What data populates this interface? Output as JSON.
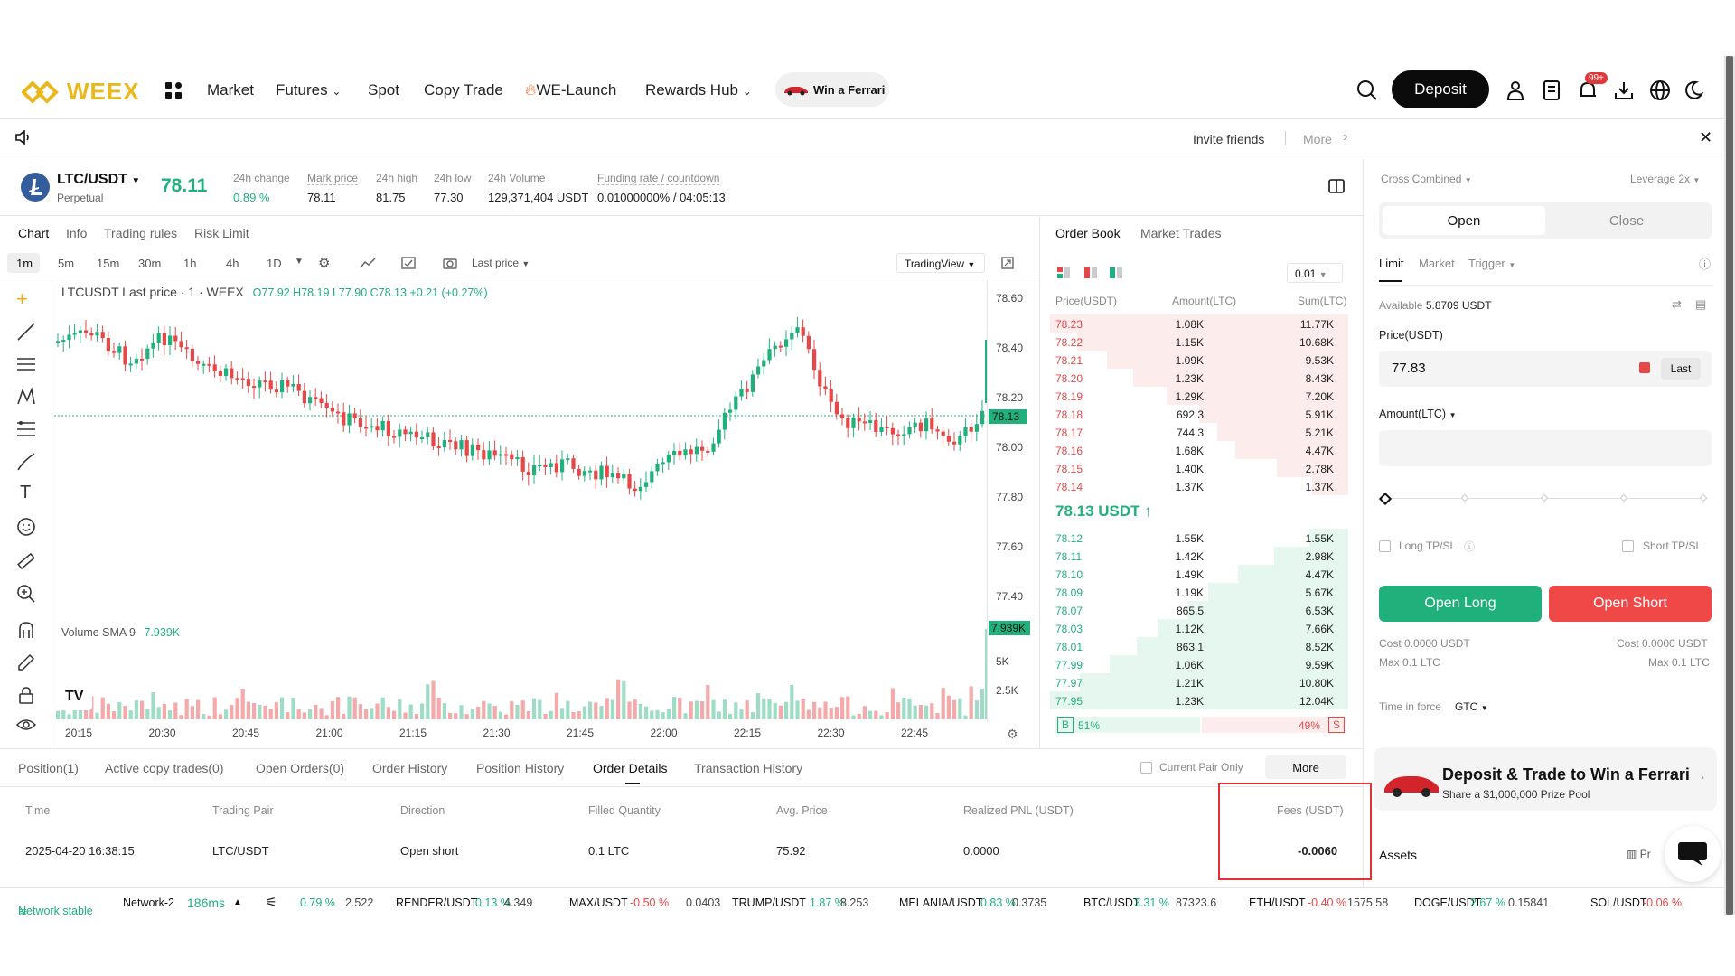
{
  "nav": {
    "brand": "WEEX",
    "market": "Market",
    "futures": "Futures",
    "spot": "Spot",
    "copy_trade": "Copy Trade",
    "we_launch": "WE-Launch",
    "rewards_hub": "Rewards Hub",
    "win_ferrari": "Win a Ferrari",
    "deposit": "Deposit",
    "notif_badge": "99+"
  },
  "announce": {
    "invite": "Invite friends",
    "more": "More"
  },
  "ticker": {
    "pair": "LTC/USDT",
    "type": "Perpetual",
    "price": "78.11",
    "change_lbl": "24h change",
    "change_val": "0.89 %",
    "mark_lbl": "Mark price",
    "mark_val": "78.11",
    "high_lbl": "24h high",
    "high_val": "81.75",
    "low_lbl": "24h low",
    "low_val": "77.30",
    "vol_lbl": "24h Volume",
    "vol_val": "129,371,404 USDT",
    "fund_lbl": "Funding rate / countdown",
    "fund_val": "0.01000000% / 04:05:13"
  },
  "chart_tabs": {
    "chart": "Chart",
    "info": "Info",
    "rules": "Trading rules",
    "risk": "Risk Limit"
  },
  "timeframes": [
    "1m",
    "5m",
    "15m",
    "30m",
    "1h",
    "4h",
    "1D"
  ],
  "chart_toolbar": {
    "last_price": "Last price",
    "tradingview": "TradingView"
  },
  "chart_legend": {
    "title": "LTCUSDT Last price · 1 · WEEX",
    "o": "O77.92",
    "h": "H78.19",
    "l": "L77.90",
    "c": "C78.13",
    "chg": "+0.21 (+0.27%)",
    "vol_lbl": "Volume SMA 9",
    "vol_val": "7.939K"
  },
  "price_axis": [
    "78.60",
    "78.40",
    "78.20",
    "78.00",
    "77.80",
    "77.60",
    "77.40"
  ],
  "price_tag": "78.13",
  "vol_axis": [
    "5K",
    "2.5K"
  ],
  "vol_tag": "7.939K",
  "time_axis": [
    "20:15",
    "20:30",
    "20:45",
    "21:00",
    "21:15",
    "21:30",
    "21:45",
    "22:00",
    "22:15",
    "22:30",
    "22:45"
  ],
  "orderbook": {
    "tab_book": "Order Book",
    "tab_trades": "Market Trades",
    "precision": "0.01",
    "h_price": "Price(USDT)",
    "h_amount": "Amount(LTC)",
    "h_sum": "Sum(LTC)",
    "asks": [
      [
        "78.23",
        "1.08K",
        "11.77K",
        1.0
      ],
      [
        "78.22",
        "1.15K",
        "10.68K",
        0.91
      ],
      [
        "78.21",
        "1.09K",
        "9.53K",
        0.81
      ],
      [
        "78.20",
        "1.23K",
        "8.43K",
        0.72
      ],
      [
        "78.19",
        "1.29K",
        "7.20K",
        0.61
      ],
      [
        "78.18",
        "692.3",
        "5.91K",
        0.5
      ],
      [
        "78.17",
        "744.3",
        "5.21K",
        0.44
      ],
      [
        "78.16",
        "1.68K",
        "4.47K",
        0.38
      ],
      [
        "78.15",
        "1.40K",
        "2.78K",
        0.24
      ],
      [
        "78.14",
        "1.37K",
        "1.37K",
        0.12
      ]
    ],
    "mid": "78.13 USDT",
    "bids": [
      [
        "78.12",
        "1.55K",
        "1.55K",
        0.13
      ],
      [
        "78.11",
        "1.42K",
        "2.98K",
        0.25
      ],
      [
        "78.10",
        "1.49K",
        "4.47K",
        0.37
      ],
      [
        "78.09",
        "1.19K",
        "5.67K",
        0.47
      ],
      [
        "78.07",
        "865.5",
        "6.53K",
        0.54
      ],
      [
        "78.03",
        "1.12K",
        "7.66K",
        0.64
      ],
      [
        "78.01",
        "863.1",
        "8.52K",
        0.71
      ],
      [
        "77.99",
        "1.06K",
        "9.59K",
        0.8
      ],
      [
        "77.97",
        "1.21K",
        "10.80K",
        0.9
      ],
      [
        "77.95",
        "1.23K",
        "12.04K",
        1.0
      ]
    ],
    "buy_pct": "51%",
    "sell_pct": "49%",
    "b": "B",
    "s": "S"
  },
  "order_panel": {
    "margin_mode": "Cross Combined",
    "leverage": "Leverage 2x",
    "open": "Open",
    "close": "Close",
    "limit": "Limit",
    "market": "Market",
    "trigger": "Trigger",
    "available_lbl": "Available",
    "available_val": "5.8709 USDT",
    "price_lbl": "Price(USDT)",
    "price_val": "77.83",
    "last": "Last",
    "amount_lbl": "Amount(LTC)",
    "long_tpsl": "Long TP/SL",
    "short_tpsl": "Short TP/SL",
    "open_long": "Open Long",
    "open_short": "Open Short",
    "cost_long": "Cost 0.0000 USDT",
    "cost_short": "Cost 0.0000 USDT",
    "max_long": "Max 0.1 LTC",
    "max_short": "Max 0.1 LTC",
    "tif_lbl": "Time in force",
    "tif_val": "GTC",
    "promo_title": "Deposit & Trade to Win a Ferrari",
    "promo_sub": "Share a $1,000,000 Prize Pool",
    "assets": "Assets",
    "assets_right": "Pr"
  },
  "bottom_tabs": [
    "Position(1)",
    "Active copy trades(0)",
    "Open Orders(0)",
    "Order History",
    "Position History",
    "Order Details",
    "Transaction History"
  ],
  "current_pair_only": "Current Pair Only",
  "more_btn": "More",
  "order_table": {
    "headers": [
      "Time",
      "Trading Pair",
      "Direction",
      "Filled Quantity",
      "Avg. Price",
      "Realized PNL (USDT)",
      "Fees (USDT)"
    ],
    "row": [
      "2025-04-20 16:38:15",
      "LTC/USDT",
      "Open short",
      "0.1 LTC",
      "75.92",
      "0.0000",
      "-0.0060"
    ]
  },
  "status": {
    "network": "Network stable",
    "network_name": "Network-2",
    "latency": "186ms"
  },
  "ticker_bar": [
    [
      "",
      "0.79 %",
      "2.522",
      "g"
    ],
    [
      "RENDER/USDT",
      "0.13 %",
      "4.349",
      "g"
    ],
    [
      "MAX/USDT",
      "-0.50 %",
      "0.0403",
      "r"
    ],
    [
      "TRUMP/USDT",
      "1.87 %",
      "8.253",
      "g"
    ],
    [
      "MELANIA/USDT",
      "0.83 %",
      "0.3735",
      "g"
    ],
    [
      "BTC/USDT",
      "3.31 %",
      "87323.6",
      "g"
    ],
    [
      "ETH/USDT",
      "-0.40 %",
      "1575.58",
      "r"
    ],
    [
      "DOGE/USDT",
      "2.67 %",
      "0.15841",
      "g"
    ],
    [
      "SOL/USDT",
      "-0.06 %",
      "",
      "r"
    ]
  ],
  "colors": {
    "up": "#20b07c",
    "down": "#e64747",
    "brand": "#e8b81e",
    "highlight": "#e0303a"
  }
}
